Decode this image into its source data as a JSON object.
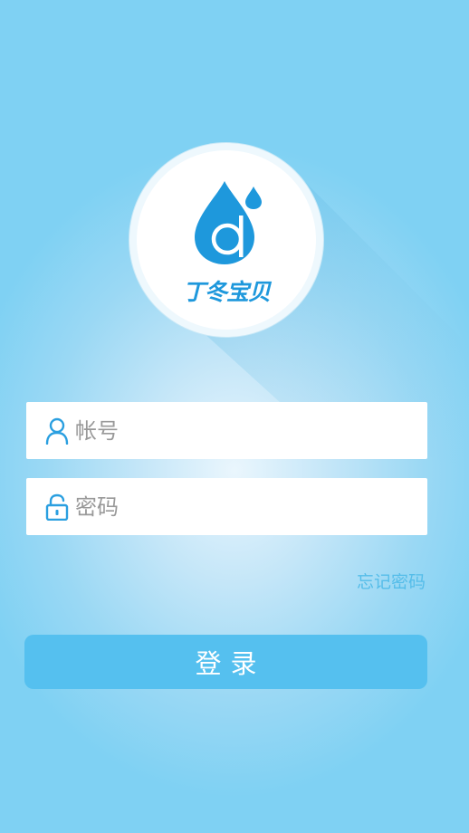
{
  "logo": {
    "brand_text": "丁冬宝贝",
    "icon": "water-drop-logo-icon"
  },
  "login_form": {
    "account_placeholder": "帐号",
    "account_icon": "user-icon",
    "password_placeholder": "密码",
    "password_icon": "lock-icon",
    "forgot_password_label": "忘记密码",
    "login_button_label": "登录"
  },
  "colors": {
    "background": "#7fd1f3",
    "accent": "#1e98dc",
    "button": "#55c0ef",
    "link": "#55bde9"
  }
}
